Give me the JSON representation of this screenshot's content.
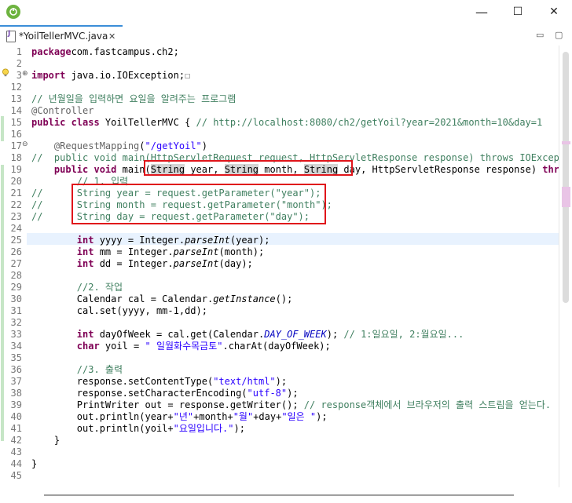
{
  "window": {
    "minimize_label": "—",
    "maximize_label": "☐",
    "close_label": "✕"
  },
  "tab": {
    "label": "*YoilTellerMVC.java",
    "close_label": "✕",
    "minimize_label": "▭",
    "maximize_label": "▢"
  },
  "colors": {
    "accent": "#3b8ed8",
    "highlight_box": "#e0151b",
    "keyword": "#7f0055",
    "comment": "#3f7f5f",
    "string": "#2a00ff"
  },
  "icons": {
    "app": "spring-leaf-icon",
    "file": "java-file-icon",
    "warning": "warning-lightbulb-icon",
    "fold": "fold-toggle-icon"
  },
  "lines": [
    {
      "n": "1",
      "t": [
        [
          "kw",
          "package"
        ],
        [
          "",
          "com.fastcampus.ch2;"
        ]
      ]
    },
    {
      "n": "2",
      "t": []
    },
    {
      "n": "3",
      "t": [
        [
          "kw",
          "import"
        ],
        [
          "",
          " java.io.IOException;"
        ],
        [
          "box",
          "☐"
        ]
      ]
    },
    {
      "n": "12",
      "t": []
    },
    {
      "n": "13",
      "t": [
        [
          "cm",
          "// 년월일을 입력하면 요일을 알려주는 프로그램"
        ]
      ]
    },
    {
      "n": "14",
      "t": [
        [
          "an",
          "@Controller"
        ]
      ]
    },
    {
      "n": "15",
      "t": [
        [
          "kw",
          "public class"
        ],
        [
          "",
          " YoilTellerMVC { "
        ],
        [
          "cm",
          "// http://localhost:8080/ch2/getYoil?year=2021&month=10&day=1"
        ]
      ]
    },
    {
      "n": "16",
      "t": []
    },
    {
      "n": "17",
      "t": [
        [
          "",
          "    "
        ],
        [
          "an",
          "@RequestMapping"
        ],
        [
          "",
          "("
        ],
        [
          "st",
          "\"/getYoil\""
        ],
        [
          "",
          ")"
        ]
      ]
    },
    {
      "n": "18",
      "t": [
        [
          "cm",
          "//  public void main(HttpServletRequest request, HttpServletResponse response) throws IOExcept"
        ]
      ]
    },
    {
      "n": "19",
      "t": [
        [
          "",
          "    "
        ],
        [
          "kw",
          "public void"
        ],
        [
          "",
          " main("
        ],
        [
          "hl",
          "String"
        ],
        [
          "",
          " year, "
        ],
        [
          "hl",
          "String"
        ],
        [
          "",
          " month, "
        ],
        [
          "hl",
          "String"
        ],
        [
          "",
          " day, HttpServletResponse response) "
        ],
        [
          "kw",
          "thro"
        ]
      ]
    },
    {
      "n": "20",
      "t": [
        [
          "",
          "        "
        ],
        [
          "cm",
          "// 1. 입력"
        ]
      ]
    },
    {
      "n": "21",
      "t": [
        [
          "cm",
          "//      String year = request.getParameter(\"year\");"
        ]
      ]
    },
    {
      "n": "22",
      "t": [
        [
          "cm",
          "//      String month = request.getParameter(\"month\");"
        ]
      ]
    },
    {
      "n": "23",
      "t": [
        [
          "cm",
          "//      String day = request.getParameter(\"day\");"
        ]
      ]
    },
    {
      "n": "24",
      "t": []
    },
    {
      "n": "25",
      "t": [
        [
          "",
          "        "
        ],
        [
          "kw",
          "int"
        ],
        [
          "",
          " yyyy = Integer."
        ],
        [
          "it",
          "parseInt"
        ],
        [
          "",
          "(year);"
        ]
      ]
    },
    {
      "n": "26",
      "t": [
        [
          "",
          "        "
        ],
        [
          "kw",
          "int"
        ],
        [
          "",
          " mm = Integer."
        ],
        [
          "it",
          "parseInt"
        ],
        [
          "",
          "(month);"
        ]
      ]
    },
    {
      "n": "27",
      "t": [
        [
          "",
          "        "
        ],
        [
          "kw",
          "int"
        ],
        [
          "",
          " dd = Integer."
        ],
        [
          "it",
          "parseInt"
        ],
        [
          "",
          "(day);"
        ]
      ]
    },
    {
      "n": "28",
      "t": []
    },
    {
      "n": "29",
      "t": [
        [
          "",
          "        "
        ],
        [
          "cm",
          "//2. 작업"
        ]
      ]
    },
    {
      "n": "30",
      "t": [
        [
          "",
          "        Calendar cal = Calendar."
        ],
        [
          "it",
          "getInstance"
        ],
        [
          "",
          "();"
        ]
      ]
    },
    {
      "n": "31",
      "t": [
        [
          "",
          "        cal.set(yyyy, mm-1,dd);"
        ]
      ]
    },
    {
      "n": "32",
      "t": []
    },
    {
      "n": "33",
      "t": [
        [
          "",
          "        "
        ],
        [
          "kw",
          "int"
        ],
        [
          "",
          " dayOfWeek = cal.get(Calendar."
        ],
        [
          "cst",
          "DAY_OF_WEEK"
        ],
        [
          "",
          "); "
        ],
        [
          "cm",
          "// 1:일요일, 2:월요일..."
        ]
      ]
    },
    {
      "n": "34",
      "t": [
        [
          "",
          "        "
        ],
        [
          "kw",
          "char"
        ],
        [
          "",
          " yoil = "
        ],
        [
          "st",
          "\" 일월화수목금토\""
        ],
        [
          "",
          ".charAt(dayOfWeek);"
        ]
      ]
    },
    {
      "n": "35",
      "t": []
    },
    {
      "n": "36",
      "t": [
        [
          "",
          "        "
        ],
        [
          "cm",
          "//3. 출력"
        ]
      ]
    },
    {
      "n": "37",
      "t": [
        [
          "",
          "        response.setContentType("
        ],
        [
          "st",
          "\"text/html\""
        ],
        [
          "",
          ");"
        ]
      ]
    },
    {
      "n": "38",
      "t": [
        [
          "",
          "        response.setCharacterEncoding("
        ],
        [
          "st",
          "\"utf-8\""
        ],
        [
          "",
          ");"
        ]
      ]
    },
    {
      "n": "39",
      "t": [
        [
          "",
          "        PrintWriter out = response.getWriter(); "
        ],
        [
          "cm",
          "// response객체에서 브라우저의 출력 스트림을 얻는다."
        ]
      ]
    },
    {
      "n": "40",
      "t": [
        [
          "",
          "        out.println(year+"
        ],
        [
          "st",
          "\"년\""
        ],
        [
          "",
          "+month+"
        ],
        [
          "st",
          "\"월\""
        ],
        [
          "",
          "+day+"
        ],
        [
          "st",
          "\"일은 \""
        ],
        [
          "",
          ");"
        ]
      ]
    },
    {
      "n": "41",
      "t": [
        [
          "",
          "        out.println(yoil+"
        ],
        [
          "st",
          "\"요일입니다.\""
        ],
        [
          "",
          ");"
        ]
      ]
    },
    {
      "n": "42",
      "t": [
        [
          "",
          "    }"
        ]
      ]
    },
    {
      "n": "43",
      "t": []
    },
    {
      "n": "44",
      "t": [
        [
          "",
          "}"
        ]
      ]
    },
    {
      "n": "45",
      "t": []
    }
  ]
}
